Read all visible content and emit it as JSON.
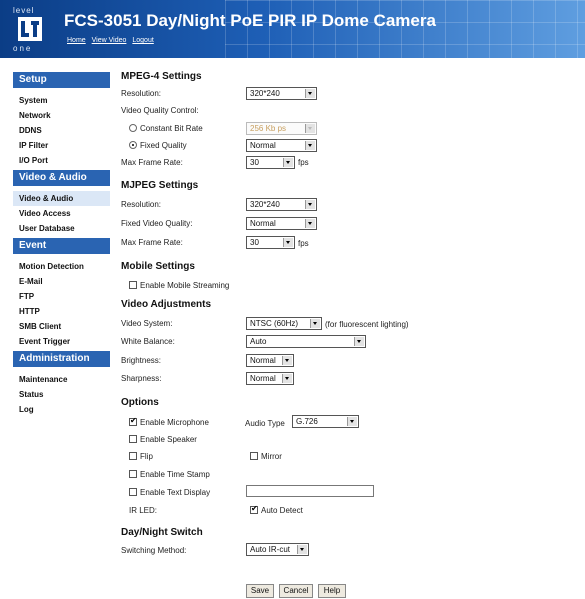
{
  "header": {
    "logo_top": "level",
    "logo_bottom": "one",
    "title": "FCS-3051 Day/Night PoE PIR IP Dome Camera",
    "links": [
      "Home",
      "View Video",
      "Logout"
    ]
  },
  "sidebar": {
    "setup": {
      "heading": "Setup",
      "items": [
        "System",
        "Network",
        "DDNS",
        "IP Filter",
        "I/O Port"
      ]
    },
    "video": {
      "heading": "Video & Audio",
      "items": [
        "Video & Audio",
        "Video Access",
        "User Database"
      ]
    },
    "event": {
      "heading": "Event",
      "items": [
        "Motion Detection",
        "E-Mail",
        "FTP",
        "HTTP",
        "SMB Client",
        "Event Trigger"
      ]
    },
    "admin": {
      "heading": "Administration",
      "items": [
        "Maintenance",
        "Status",
        "Log"
      ]
    }
  },
  "mpeg4": {
    "heading": "MPEG-4 Settings",
    "resolution_label": "Resolution:",
    "resolution_value": "320*240",
    "quality_control_label": "Video Quality Control:",
    "cbr_label": "Constant Bit Rate",
    "cbr_value": "256 Kb ps",
    "fixed_label": "Fixed Quality",
    "fixed_value": "Normal",
    "framerate_label": "Max Frame Rate:",
    "framerate_value": "30",
    "fps": "fps"
  },
  "mjpeg": {
    "heading": "MJPEG Settings",
    "resolution_label": "Resolution:",
    "resolution_value": "320*240",
    "quality_label": "Fixed Video Quality:",
    "quality_value": "Normal",
    "framerate_label": "Max Frame Rate:",
    "framerate_value": "30",
    "fps": "fps"
  },
  "mobile": {
    "heading": "Mobile Settings",
    "streaming_label": "Enable Mobile Streaming"
  },
  "adjust": {
    "heading": "Video Adjustments",
    "system_label": "Video System:",
    "system_value": "NTSC (60Hz)",
    "system_note": "(for fluorescent lighting)",
    "wb_label": "White Balance:",
    "wb_value": "Auto",
    "brightness_label": "Brightness:",
    "brightness_value": "Normal",
    "sharpness_label": "Sharpness:",
    "sharpness_value": "Normal"
  },
  "options": {
    "heading": "Options",
    "mic_label": "Enable Microphone",
    "audio_type_label": "Audio Type",
    "audio_type_value": "G.726",
    "speaker_label": "Enable Speaker",
    "flip_label": "Flip",
    "mirror_label": "Mirror",
    "timestamp_label": "Enable Time Stamp",
    "textdisplay_label": "Enable Text Display",
    "textdisplay_value": "",
    "irled_label": "IR LED:",
    "autodetect_label": "Auto Detect"
  },
  "daynight": {
    "heading": "Day/Night Switch",
    "method_label": "Switching Method:",
    "method_value": "Auto IR-cut"
  },
  "buttons": {
    "save": "Save",
    "cancel": "Cancel",
    "help": "Help"
  }
}
